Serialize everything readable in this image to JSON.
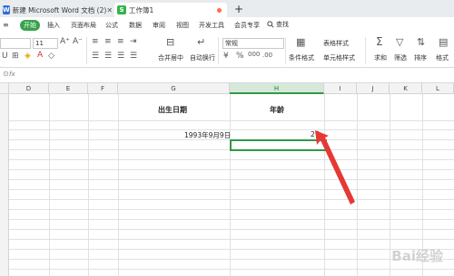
{
  "tabs": [
    {
      "icon": "W",
      "icon_color": "#2f6ed3",
      "label": "新建 Microsoft Word 文档 (2)"
    },
    {
      "icon": "S",
      "icon_color": "#33b34a",
      "label": "工作簿1"
    }
  ],
  "menu": {
    "start": "开始",
    "items": [
      "插入",
      "页面布局",
      "公式",
      "数据",
      "审阅",
      "视图",
      "开发工具",
      "会员专享"
    ],
    "search": "查找"
  },
  "ribbon": {
    "font_size": "11",
    "number_format": "常规",
    "merge_label": "合并居中",
    "wrap_label": "自动换行",
    "cond_format": "条件格式",
    "table_style": "表格样式",
    "cell_style": "单元格样式",
    "sum": "求和",
    "filter": "筛选",
    "sort": "排序",
    "format": "格式"
  },
  "formula_bar": {
    "fx": "fx"
  },
  "columns": [
    "D",
    "E",
    "F",
    "G",
    "H",
    "I",
    "J",
    "K",
    "L"
  ],
  "cells": {
    "g_header": "出生日期",
    "h_header": "年龄",
    "g_value": "1993年9月9日",
    "h_value": "27"
  },
  "watermark": "Bai经验",
  "colors": {
    "accent": "#37a24a",
    "arrow": "#e53935"
  }
}
